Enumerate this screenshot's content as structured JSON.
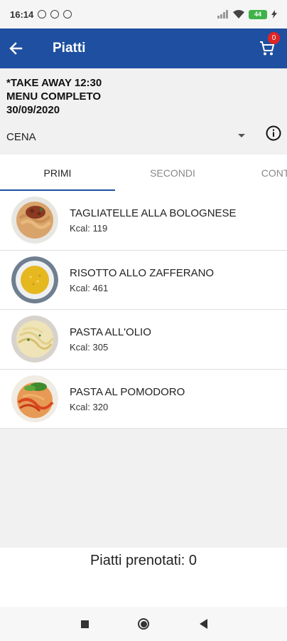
{
  "status_bar": {
    "time": "16:14",
    "battery": "44",
    "icons": [
      "alarm-icon",
      "dnd-icon",
      "sync-icon",
      "signal-icon",
      "wifi-icon",
      "charging-icon"
    ]
  },
  "app_bar": {
    "title": "Piatti",
    "back_icon": "arrow-left-icon",
    "cart_icon": "shopping-cart-icon",
    "cart_count": "0",
    "background": "#1f4fa0"
  },
  "header": {
    "line1": "*TAKE AWAY 12:30",
    "line2": "MENU COMPLETO",
    "line3": "30/09/2020"
  },
  "meal": {
    "selected": "CENA"
  },
  "tabs": [
    {
      "label": "PRIMI",
      "active": true
    },
    {
      "label": "SECONDI",
      "active": false
    },
    {
      "label": "CONTORNI",
      "active": false
    }
  ],
  "dishes": [
    {
      "name": "TAGLIATELLE ALLA BOLOGNESE",
      "kcal": "Kcal: 119",
      "image": "tagliatelle-image"
    },
    {
      "name": "RISOTTO ALLO ZAFFERANO",
      "kcal": "Kcal: 461",
      "image": "risotto-image"
    },
    {
      "name": "PASTA ALL'OLIO",
      "kcal": "Kcal: 305",
      "image": "pasta-olio-image"
    },
    {
      "name": "PASTA AL POMODORO",
      "kcal": "Kcal: 320",
      "image": "pasta-pomodoro-image"
    }
  ],
  "footer": {
    "booked": "Piatti prenotati: 0"
  },
  "nav": [
    "recents-icon",
    "home-icon",
    "back-icon"
  ]
}
